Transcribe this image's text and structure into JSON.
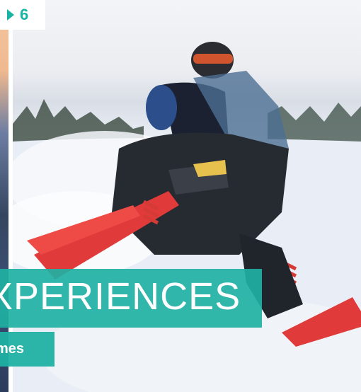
{
  "page_marker": {
    "icon": "chevron-right-icon",
    "number": "6"
  },
  "title": "XPERIENCES",
  "subtitle": "mes",
  "colors": {
    "accent": "#17b3a5",
    "band": "#20b1a3"
  }
}
